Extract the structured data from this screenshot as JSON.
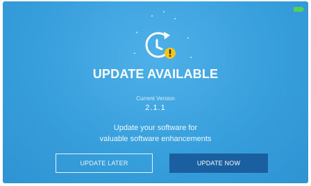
{
  "header": {
    "icon": "clock-update-icon",
    "badge_icon": "exclamation-badge-icon",
    "status_icon": "battery-icon",
    "title": "UPDATE AVAILABLE"
  },
  "version": {
    "label": "Current Version",
    "value": "2.1.1"
  },
  "message": {
    "line1": "Update your software for",
    "line2": "valuable software enhancements"
  },
  "buttons": {
    "later_label": "UPDATE LATER",
    "now_label": "UPDATE NOW"
  },
  "colors": {
    "background": "#379fdc",
    "primary_button": "#1a5fa0",
    "badge": "#f5c518",
    "battery": "#4fd15c"
  }
}
